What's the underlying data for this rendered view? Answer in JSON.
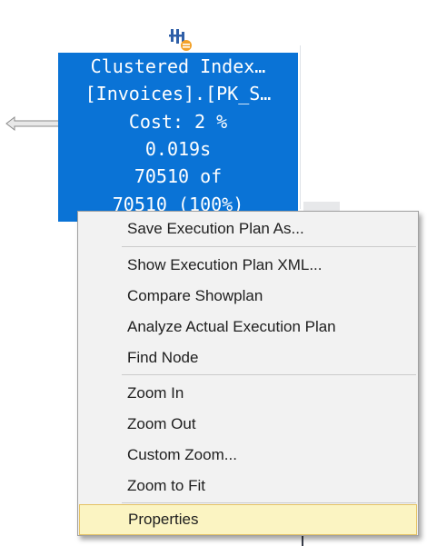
{
  "plan_node": {
    "icon": "clustered-index-scan-icon",
    "lines": [
      "Clustered Index…",
      "[Invoices].[PK_S…",
      "Cost: 2 %",
      "0.019s",
      "70510 of",
      "70510 (100%)"
    ],
    "color": "#0a73d6"
  },
  "context_menu": {
    "items": [
      {
        "label": "Save Execution Plan As..."
      },
      {
        "label": "Show Execution Plan XML..."
      },
      {
        "label": "Compare Showplan"
      },
      {
        "label": "Analyze Actual Execution Plan"
      },
      {
        "label": "Find Node"
      },
      {
        "label": "Zoom In"
      },
      {
        "label": "Zoom Out"
      },
      {
        "label": "Custom Zoom..."
      },
      {
        "label": "Zoom to Fit"
      },
      {
        "label": "Properties",
        "highlighted": true
      }
    ],
    "highlight_color": "#fbf4c2"
  }
}
